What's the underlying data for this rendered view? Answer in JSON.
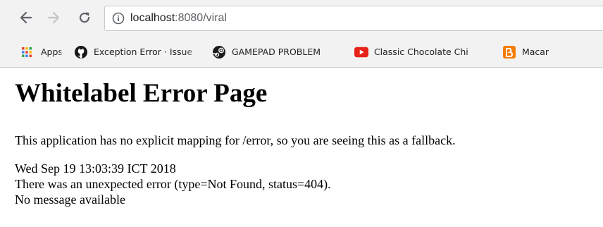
{
  "browser": {
    "url_host": "localhost",
    "url_path": ":8080/viral",
    "bookmarks": [
      {
        "label": "Apps",
        "icon": "apps-grid-icon"
      },
      {
        "label": "Exception Error · Issue",
        "icon": "github-icon"
      },
      {
        "label": "GAMEPAD PROBLEM",
        "icon": "steam-icon"
      },
      {
        "label": "Classic Chocolate Chi",
        "icon": "youtube-icon"
      },
      {
        "label": "Macar",
        "icon": "blogger-icon"
      }
    ],
    "colors": {
      "chrome_bg": "#f2f2f2",
      "youtube": "#e62117",
      "blogger": "#f57d00"
    }
  },
  "page": {
    "title": "Whitelabel Error Page",
    "explanation": "This application has no explicit mapping for /error, so you are seeing this as a fallback.",
    "timestamp": "Wed Sep 19 13:03:39 ICT 2018",
    "error": "There was an unexpected error (type=Not Found, status=404).",
    "message": "No message available"
  }
}
